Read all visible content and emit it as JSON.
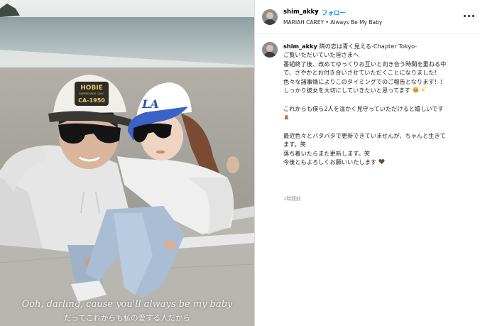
{
  "post": {
    "username": "shim_akky",
    "dot": "•",
    "follow_label": "フォロー",
    "music": "MARIAH CAREY • Always Be My Baby",
    "more_icon": "more-horizontal-icon",
    "caption_lines": [
      "隣の恋は青く見える-Chapter Tokyo-",
      "ご覧いただいていた皆さまへ",
      "番組終了後、改めてゆっくりお互いと向き合う時間を重ねる中",
      "で、さやかとお付き合いさせていただくことになりました！",
      "色々な諸事情によりこのタイミングでのご報告となります！！",
      "しっかり彼女を大切にしていきたいと思ってます"
    ],
    "caption_line_support": "これからも僕ら2人を温かく見守っていただけると嬉しいです",
    "caption_line_update_1": "最近色々とバタバタで更新できていませんが、ちゃんと生きて",
    "caption_line_update_2": "ます。笑",
    "caption_line_update_3": "落ち着いたらまた更新します。笑",
    "caption_line_update_4": "今後ともよろしくお願いいたします",
    "time_ago": "1時間前"
  },
  "photo": {
    "subtitle_en": "Ooh, darling, cause you'll always be my baby",
    "subtitle_jp": "だってこれからも私の愛する人だから",
    "cap_left_text_1": "HOBIE",
    "cap_left_text_2": "SURFBOARDS CALIF.",
    "cap_left_text_3": "CA-1950",
    "cap_right_logo": "LA"
  },
  "colors": {
    "follow_blue": "#0095f6",
    "text_dark": "#262626",
    "time_gray": "#8e8e8e",
    "divider": "#dbdbdb",
    "cap_blue": "#3a62c9"
  }
}
